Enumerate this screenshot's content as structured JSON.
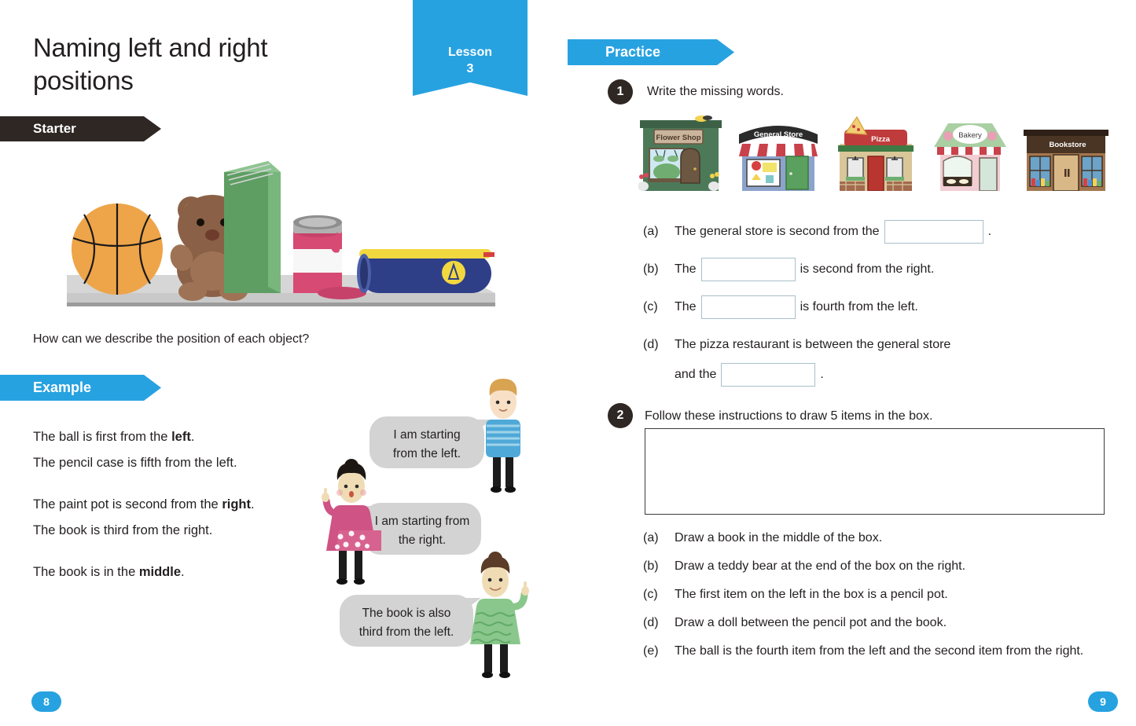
{
  "left_page": {
    "title": "Naming left and right positions",
    "lesson_ribbon": {
      "word": "Lesson",
      "number": "3"
    },
    "starter_banner": "Starter",
    "starter_question": "How can we describe the position of each object?",
    "shelf_items": [
      "basketball",
      "teddy-bear",
      "green-book",
      "paint-pot",
      "pencil-case"
    ],
    "example_banner": "Example",
    "example_lines": [
      {
        "prefix": "The ball is first from the ",
        "bold": "left",
        "suffix": "."
      },
      {
        "prefix": "The pencil case is fifth from the left.",
        "bold": "",
        "suffix": ""
      },
      {
        "prefix": "The paint pot is second from the ",
        "bold": "right",
        "suffix": "."
      },
      {
        "prefix": "The book is third from the right.",
        "bold": "",
        "suffix": ""
      },
      {
        "prefix": "The book is in the ",
        "bold": "middle",
        "suffix": "."
      }
    ],
    "speech_bubbles": [
      "I am starting from the left.",
      "I am starting from the right.",
      "The book is also third from the left."
    ],
    "page_number": "8"
  },
  "right_page": {
    "practice_banner": "Practice",
    "question1": {
      "number": "1",
      "prompt": "Write the missing words.",
      "shops": [
        "Flower Shop",
        "General Store",
        "Pizza",
        "Bakery",
        "Bookstore"
      ],
      "parts": [
        {
          "label": "(a)",
          "before": "The general store  is second from the",
          "box": "",
          "after": "."
        },
        {
          "label": "(b)",
          "before": "The",
          "box": "",
          "after": "is second from the right."
        },
        {
          "label": "(c)",
          "before": "The",
          "box": "",
          "after": "is fourth from the left."
        },
        {
          "label": "(d)",
          "before": "The pizza restaurant is between the general  store",
          "box": "",
          "after": ".",
          "second_line_before": "and the"
        }
      ]
    },
    "question2": {
      "number": "2",
      "prompt": "Follow these instructions to draw 5 items in the box.",
      "instructions": [
        {
          "label": "(a)",
          "text": "Draw a book in the middle of the box."
        },
        {
          "label": "(b)",
          "text": "Draw a teddy bear at the end of the box on the right."
        },
        {
          "label": "(c)",
          "text": "The first item on the left in the box is a pencil pot."
        },
        {
          "label": "(d)",
          "text": "Draw a doll between the pencil pot and the book."
        },
        {
          "label": "(e)",
          "text": "The ball is the fourth item from the left and the second item from the right."
        }
      ]
    },
    "page_number": "9"
  },
  "colors": {
    "accent_blue": "#27a2e0",
    "banner_dark": "#2e2723",
    "answer_box_border": "#a9c0ca",
    "draw_box_border": "#3b3b3b",
    "text": "#231f20"
  }
}
